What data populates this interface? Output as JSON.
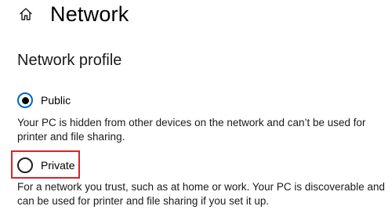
{
  "header": {
    "home_icon": "home-icon",
    "title": "Network"
  },
  "network_profile": {
    "heading": "Network profile",
    "options": [
      {
        "label": "Public",
        "selected": true,
        "description": "Your PC is hidden from other devices on the network and can’t be used for printer and file sharing."
      },
      {
        "label": "Private",
        "selected": false,
        "description": "For a network you trust, such as at home or work. Your PC is discoverable and can be used for printer and file sharing if you set it up."
      }
    ]
  },
  "colors": {
    "accent": "#0067c0",
    "highlight": "#d9232d",
    "text": "#000000"
  }
}
